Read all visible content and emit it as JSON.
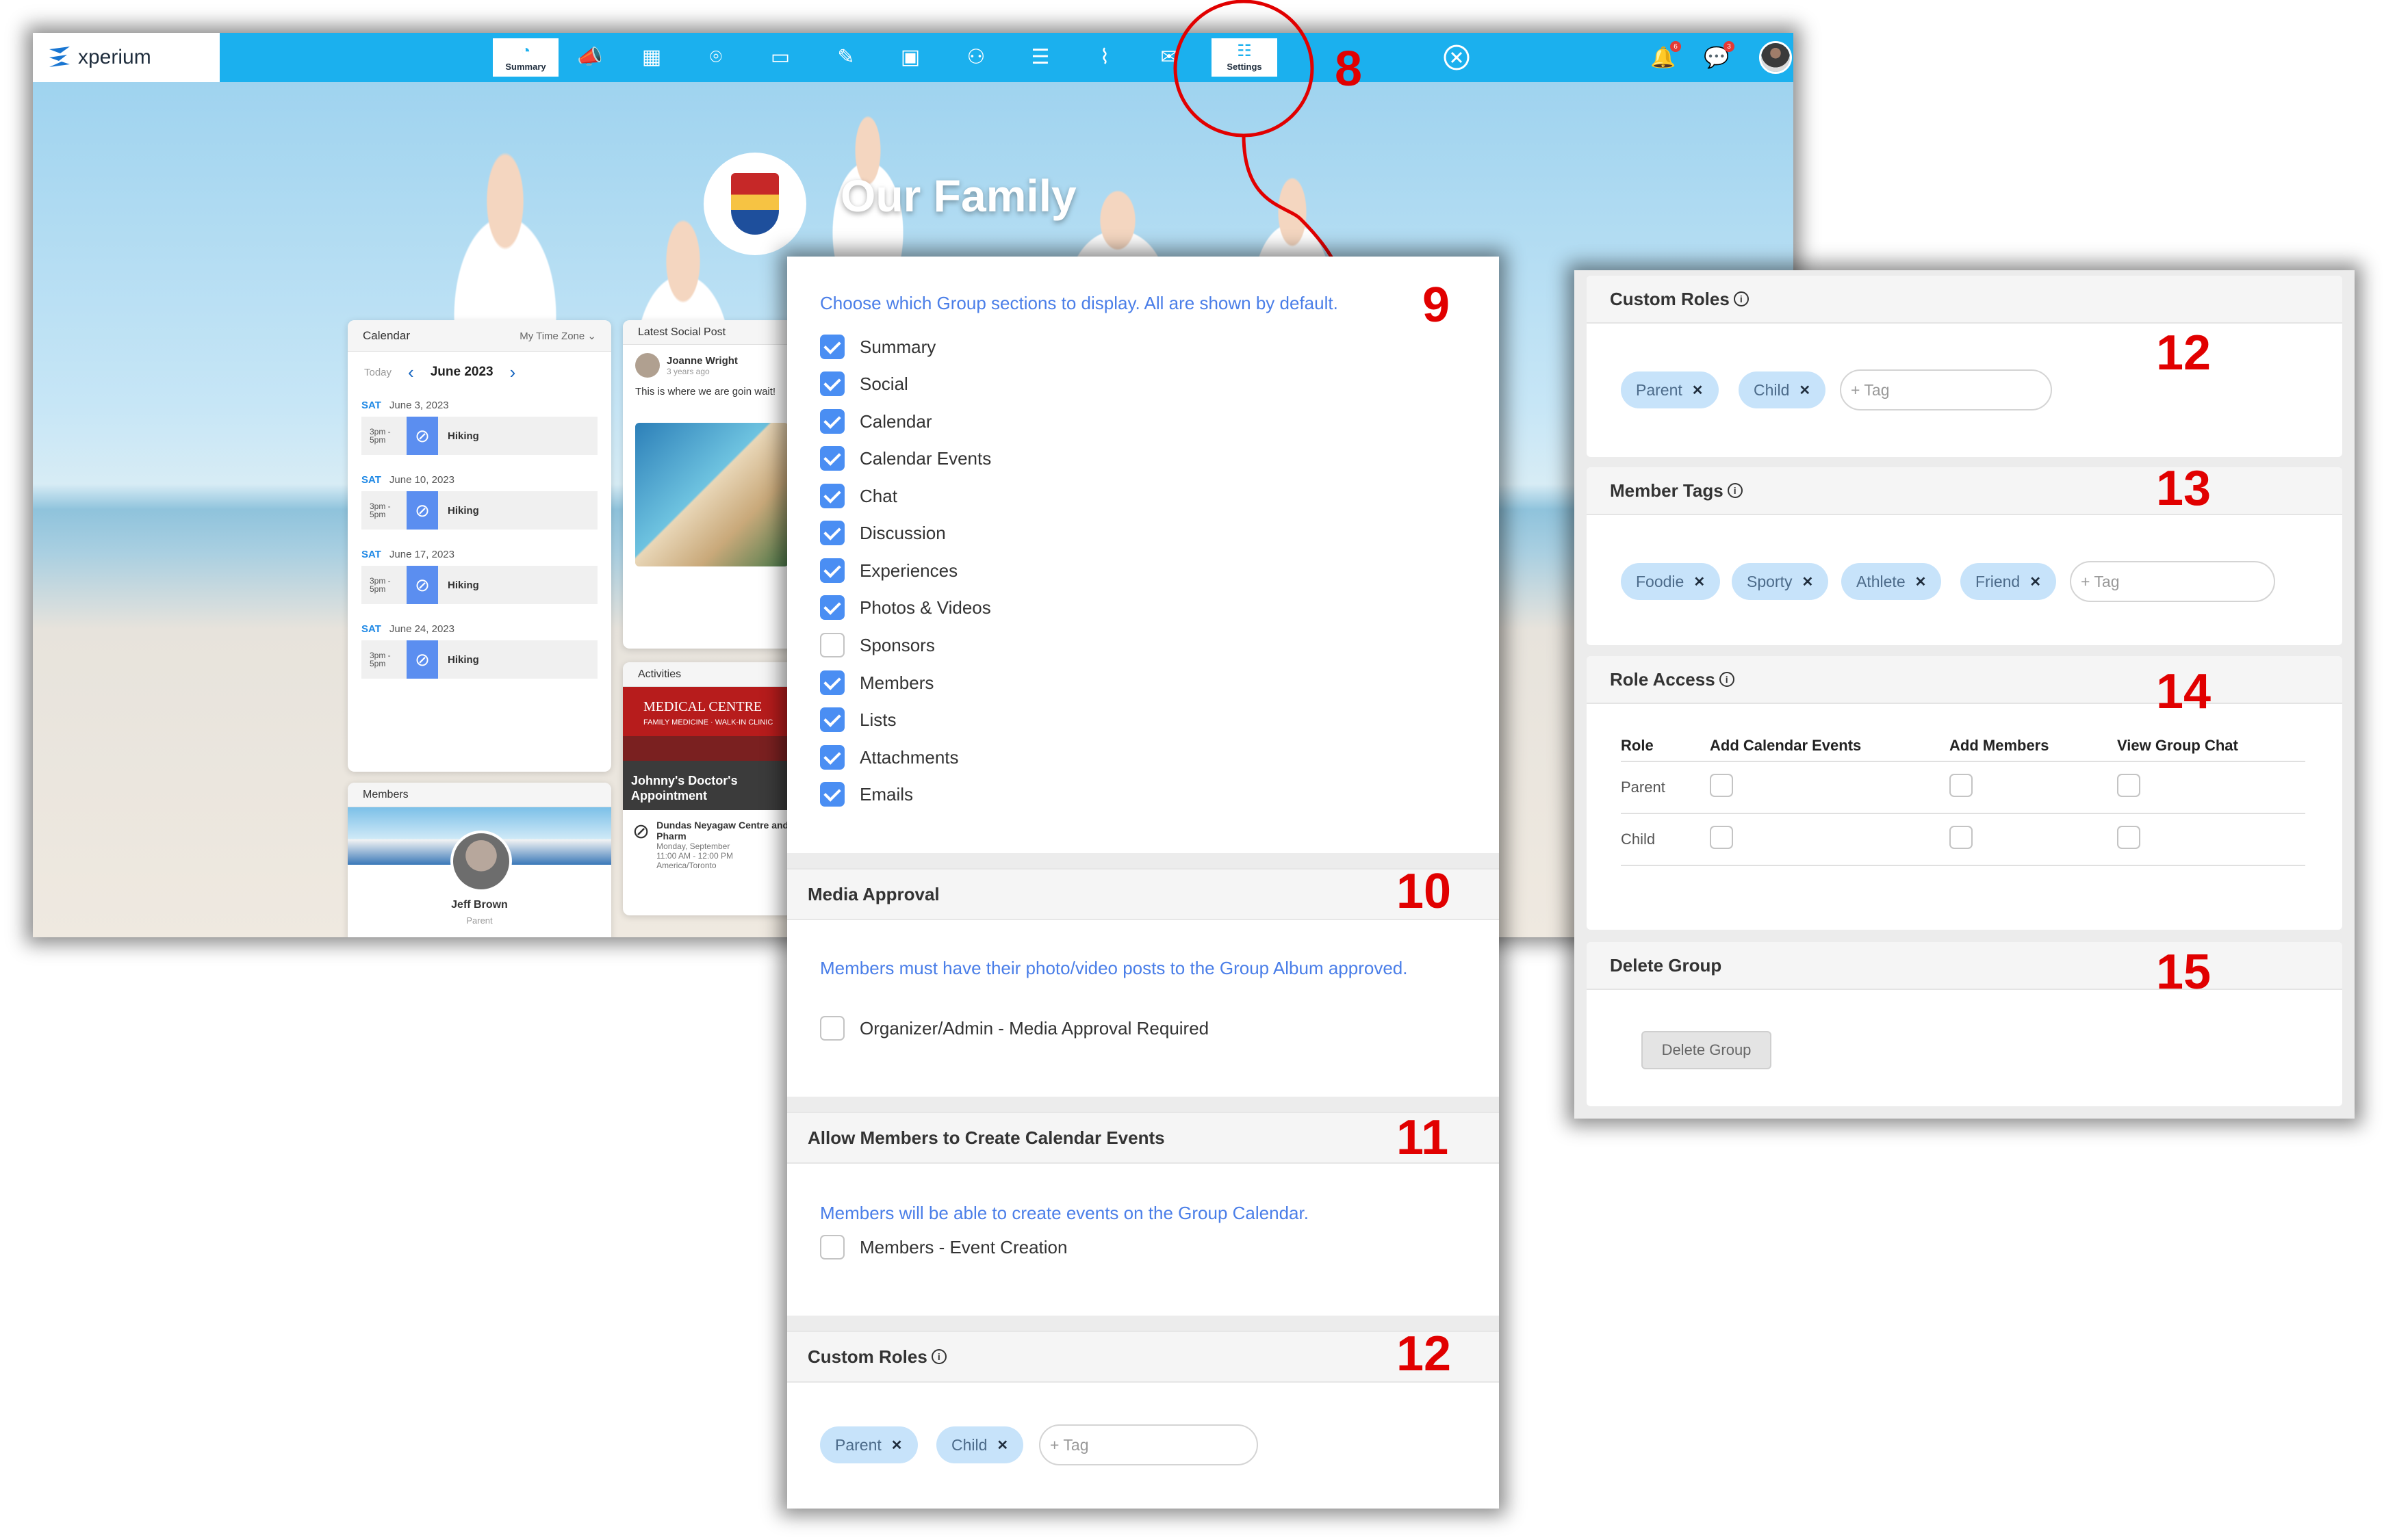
{
  "app": {
    "logo_text": "xperium",
    "nav": [
      {
        "icon": "dashboard-icon",
        "label": "Summary",
        "active": true
      },
      {
        "icon": "megaphone-icon"
      },
      {
        "icon": "calendar-icon"
      },
      {
        "icon": "map-pin-icon"
      },
      {
        "icon": "chat-icon"
      },
      {
        "icon": "feather-icon"
      },
      {
        "icon": "photo-icon"
      },
      {
        "icon": "members-icon"
      },
      {
        "icon": "list-icon"
      },
      {
        "icon": "paperclip-icon"
      },
      {
        "icon": "email-icon"
      },
      {
        "icon": "sliders-icon",
        "label": "Settings",
        "active": true
      }
    ],
    "notifications_count": "6",
    "messages_count": "3",
    "hero_title": "Our Family",
    "calendar": {
      "title": "Calendar",
      "timezone": "My Time Zone",
      "today": "Today",
      "month": "June 2023",
      "days": [
        {
          "dow": "SAT",
          "date": "June 3, 2023",
          "time_start": "3pm -",
          "time_end": "5pm",
          "event": "Hiking"
        },
        {
          "dow": "SAT",
          "date": "June 10, 2023",
          "time_start": "3pm -",
          "time_end": "5pm",
          "event": "Hiking"
        },
        {
          "dow": "SAT",
          "date": "June 17, 2023",
          "time_start": "3pm -",
          "time_end": "5pm",
          "event": "Hiking"
        },
        {
          "dow": "SAT",
          "date": "June 24, 2023",
          "time_start": "3pm -",
          "time_end": "5pm",
          "event": "Hiking"
        }
      ]
    },
    "members": {
      "title": "Members",
      "name": "Jeff Brown",
      "role": "Parent"
    },
    "social": {
      "title": "Latest Social Post",
      "author": "Joanne Wright",
      "ago": "3 years ago",
      "text": "This is where we are goin wait!"
    },
    "activities": {
      "title": "Activities",
      "sign_text": "MEDICAL CENTRE",
      "sign_sub": "FAMILY MEDICINE · WALK-IN CLINIC",
      "image_caption": "Johnny's Doctor's Appointment",
      "place": "Dundas Neyagaw Centre and Pharm",
      "date": "Monday, September",
      "time": "11:00 AM - 12:00 PM",
      "tz": "America/Toronto"
    }
  },
  "panel1": {
    "sections_desc": "Choose which Group sections to display. All are shown by default.",
    "sections": [
      {
        "label": "Summary",
        "checked": true
      },
      {
        "label": "Social",
        "checked": true
      },
      {
        "label": "Calendar",
        "checked": true
      },
      {
        "label": "Calendar Events",
        "checked": true
      },
      {
        "label": "Chat",
        "checked": true
      },
      {
        "label": "Discussion",
        "checked": true
      },
      {
        "label": "Experiences",
        "checked": true
      },
      {
        "label": "Photos & Videos",
        "checked": true
      },
      {
        "label": "Sponsors",
        "checked": false
      },
      {
        "label": "Members",
        "checked": true
      },
      {
        "label": "Lists",
        "checked": true
      },
      {
        "label": "Attachments",
        "checked": true
      },
      {
        "label": "Emails",
        "checked": true
      }
    ],
    "media_approval": {
      "title": "Media Approval",
      "desc": "Members must have their photo/video posts to the Group Album approved.",
      "option": "Organizer/Admin - Media Approval Required",
      "checked": false
    },
    "member_events": {
      "title": "Allow Members to Create Calendar Events",
      "desc": "Members will be able to create events on the Group Calendar.",
      "option": "Members - Event Creation",
      "checked": false
    },
    "custom_roles": {
      "title": "Custom Roles",
      "tags": [
        "Parent",
        "Child"
      ],
      "placeholder": "+ Tag"
    }
  },
  "panel2": {
    "custom_roles": {
      "title": "Custom Roles",
      "tags": [
        "Parent",
        "Child"
      ],
      "placeholder": "+ Tag"
    },
    "member_tags": {
      "title": "Member Tags",
      "tags": [
        "Foodie",
        "Sporty",
        "Athlete",
        "Friend"
      ],
      "placeholder": "+ Tag"
    },
    "role_access": {
      "title": "Role Access",
      "headers": [
        "Role",
        "Add Calendar Events",
        "Add Members",
        "View Group Chat"
      ],
      "rows": [
        {
          "role": "Parent",
          "values": [
            false,
            false,
            false
          ]
        },
        {
          "role": "Child",
          "values": [
            false,
            false,
            false
          ]
        }
      ]
    },
    "delete_group": {
      "title": "Delete Group",
      "button": "Delete Group"
    }
  },
  "callouts": {
    "settings": "8",
    "sections": "9",
    "media": "10",
    "events": "11",
    "roles_center": "12",
    "roles_right": "12",
    "tags": "13",
    "access": "14",
    "delete": "15"
  },
  "colors": {
    "topbar": "#1bb0ee",
    "accent_blue": "#4a8ef3",
    "desc_blue": "#4a7ee8",
    "tag_bg": "#c7e3fa",
    "callout_red": "#e10000"
  }
}
